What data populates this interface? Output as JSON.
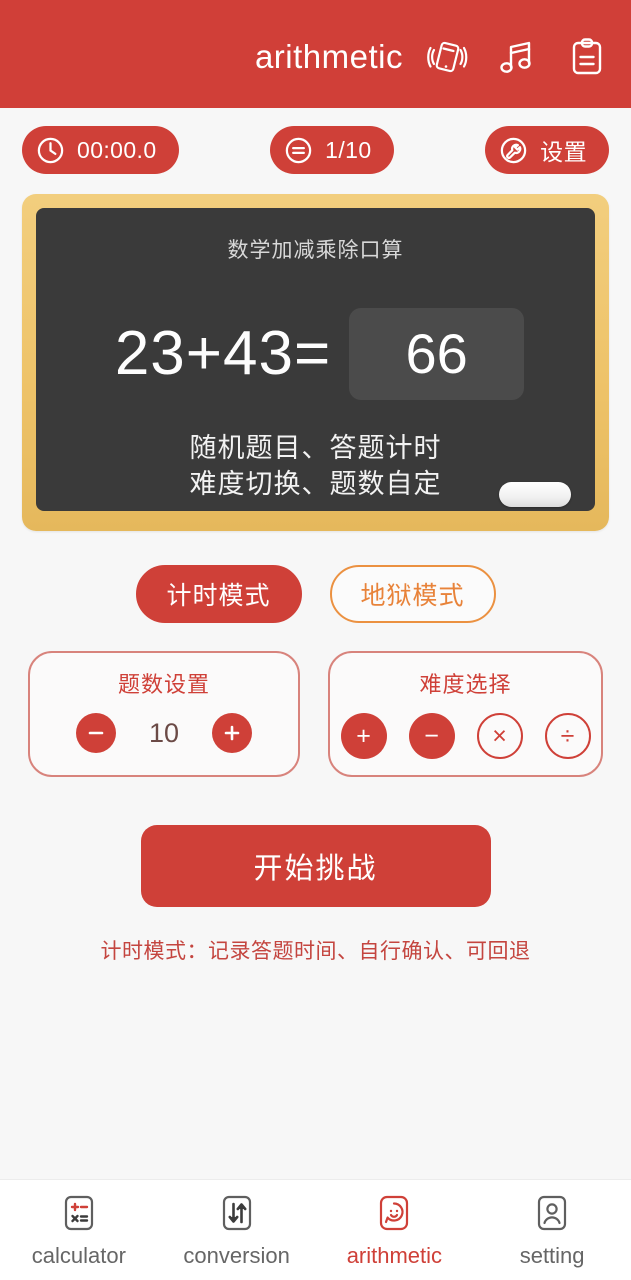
{
  "header": {
    "title": "arithmetic",
    "icons": [
      {
        "name": "vibration-icon",
        "label": "vibration"
      },
      {
        "name": "music-icon",
        "label": "music"
      },
      {
        "name": "clipboard-icon",
        "label": "records"
      }
    ]
  },
  "status_bar": {
    "timer": {
      "icon": "clock-icon",
      "value": "00:00.0"
    },
    "progress": {
      "icon": "equals-circle-icon",
      "value": "1/10"
    },
    "settings": {
      "icon": "wrench-icon",
      "label": "设置"
    }
  },
  "blackboard": {
    "title": "数学加减乘除口算",
    "equation": "23+43=",
    "answer": "66",
    "desc_line1": "随机题目、答题计时",
    "desc_line2": "难度切换、题数自定",
    "eraser": "eraser"
  },
  "modes": [
    {
      "label": "计时模式",
      "selected": true
    },
    {
      "label": "地狱模式",
      "selected": false
    }
  ],
  "count_card": {
    "title": "题数设置",
    "value": "10",
    "decrease": "−",
    "increase": "+"
  },
  "difficulty_card": {
    "title": "难度选择",
    "options": [
      {
        "symbol": "+",
        "selected": true
      },
      {
        "symbol": "−",
        "selected": true
      },
      {
        "symbol": "×",
        "selected": false
      },
      {
        "symbol": "÷",
        "selected": false
      }
    ]
  },
  "start_button": {
    "label": "开始挑战"
  },
  "hint": {
    "text": "计时模式：记录答题时间、自行确认、可回退"
  },
  "bottom_nav": {
    "items": [
      {
        "label": "calculator",
        "icon": "calculator-icon",
        "active": false
      },
      {
        "label": "conversion",
        "icon": "conversion-icon",
        "active": false
      },
      {
        "label": "arithmetic",
        "icon": "arithmetic-icon",
        "active": true
      },
      {
        "label": "setting",
        "icon": "person-icon",
        "active": false
      }
    ]
  },
  "colors": {
    "brand_red": "#cf4038",
    "header_red": "#d03f38",
    "board_dark": "#3a3a3a",
    "board_frame": "#eec369",
    "hell_orange": "#eb9141",
    "page_bg": "#f7f7f7"
  }
}
